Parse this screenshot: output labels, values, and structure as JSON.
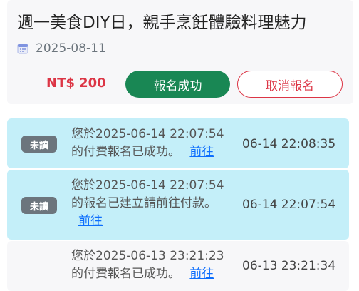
{
  "event": {
    "title": "週一美食DIY日，親手烹飪體驗料理魅力",
    "date": "2025-08-11",
    "price": "NT$ 200",
    "status_button": "報名成功",
    "cancel_button": "取消報名",
    "calendar_icon": "calendar-icon"
  },
  "notifications": [
    {
      "badge": "未讀",
      "line1": "您於2025-06-14 22:07:54",
      "line2": "的付費報名已成功。",
      "link": "前往",
      "time": "06-14 22:08:35"
    },
    {
      "badge": "未讀",
      "line1": "您於2025-06-14 22:07:54",
      "line2": "的報名已建立請前往付款。",
      "link": "前往",
      "time": "06-14 22:07:54"
    },
    {
      "line1": "您於2025-06-13 23:21:23",
      "line2": "的付費報名已成功。",
      "link": "前往",
      "time": "06-13 23:21:34"
    }
  ],
  "colors": {
    "unread_bg": "#c4eff9",
    "read_bg": "#f7f7f9",
    "success": "#198754",
    "danger": "#dc3545",
    "link": "#0d6efd"
  }
}
